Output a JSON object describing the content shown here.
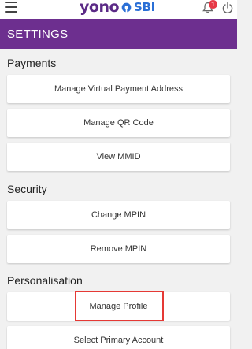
{
  "topbar": {
    "brand_yono": "yono",
    "brand_sbi": "SBI",
    "notification_count": "1"
  },
  "header": {
    "title": "SETTINGS",
    "color": "#6d2f8f"
  },
  "sections": [
    {
      "title": "Payments",
      "items": [
        "Manage Virtual Payment Address",
        "Manage QR Code",
        "View MMID"
      ]
    },
    {
      "title": "Security",
      "items": [
        "Change MPIN",
        "Remove MPIN"
      ]
    },
    {
      "title": "Personalisation",
      "items": [
        "Manage Profile",
        "Select Primary Account"
      ]
    }
  ],
  "icons": {
    "menu": "hamburger-menu-icon",
    "bell": "notification-bell-icon",
    "power": "power-icon",
    "logo": "sbi-logo-icon"
  },
  "highlight_color": "#e53935"
}
